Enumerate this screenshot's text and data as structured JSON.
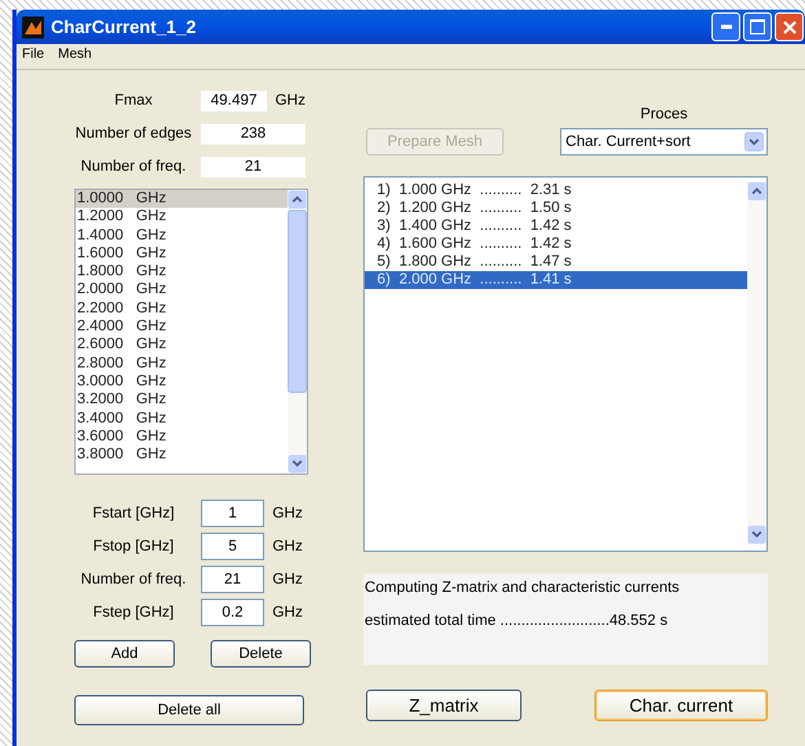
{
  "window": {
    "title": "CharCurrent_1_2"
  },
  "menu": [
    "File",
    "Mesh"
  ],
  "info_fields": [
    {
      "label": "Fmax",
      "value": "49.497",
      "unit": "GHz"
    },
    {
      "label": "Number of edges",
      "value": "238"
    },
    {
      "label": "Number of freq.",
      "value": "21"
    }
  ],
  "frequency_list": [
    {
      "text": "1.0000   GHz",
      "selected": true
    },
    {
      "text": "1.2000   GHz",
      "selected": false
    },
    {
      "text": "1.4000   GHz",
      "selected": false
    },
    {
      "text": "1.6000   GHz",
      "selected": false
    },
    {
      "text": "1.8000   GHz",
      "selected": false
    },
    {
      "text": "2.0000   GHz",
      "selected": false
    },
    {
      "text": "2.2000   GHz",
      "selected": false
    },
    {
      "text": "2.4000   GHz",
      "selected": false
    },
    {
      "text": "2.6000   GHz",
      "selected": false
    },
    {
      "text": "2.8000   GHz",
      "selected": false
    },
    {
      "text": "3.0000   GHz",
      "selected": false
    },
    {
      "text": "3.2000   GHz",
      "selected": false
    },
    {
      "text": "3.4000   GHz",
      "selected": false
    },
    {
      "text": "3.6000   GHz",
      "selected": false
    },
    {
      "text": "3.8000   GHz",
      "selected": false
    }
  ],
  "range_fields": [
    {
      "label": "Fstart [GHz]",
      "value": "1",
      "unit": "GHz"
    },
    {
      "label": "Fstop [GHz]",
      "value": "5",
      "unit": "GHz"
    },
    {
      "label": "Number of freq.",
      "value": "21",
      "unit": "GHz"
    },
    {
      "label": "Fstep [GHz]",
      "value": "0.2",
      "unit": "GHz"
    }
  ],
  "list_buttons": [
    {
      "label": "Add"
    },
    {
      "label": "Delete"
    }
  ],
  "delete_all_button": {
    "label": "Delete all"
  },
  "prepare_mesh_button": {
    "label": "Prepare Mesh",
    "disabled": true
  },
  "process": {
    "label": "Proces",
    "value": "Char. Current+sort"
  },
  "results": [
    {
      "text": " 1)  1.000 GHz  ..........  2.31 s",
      "selected": false
    },
    {
      "text": " 2)  1.200 GHz  ..........  1.50 s",
      "selected": false
    },
    {
      "text": " 3)  1.400 GHz  ..........  1.42 s",
      "selected": false
    },
    {
      "text": " 4)  1.600 GHz  ..........  1.42 s",
      "selected": false
    },
    {
      "text": " 5)  1.800 GHz  ..........  1.47 s",
      "selected": false
    },
    {
      "text": " 6)  2.000 GHz  ..........  1.41 s",
      "selected": true
    }
  ],
  "status_lines": [
    "Computing Z-matrix and characteristic currents",
    "estimated total time ..........................48.552 s"
  ],
  "action_buttons": [
    {
      "label": "Z_matrix",
      "focused": false
    },
    {
      "label": "Char. current",
      "focused": true
    }
  ]
}
